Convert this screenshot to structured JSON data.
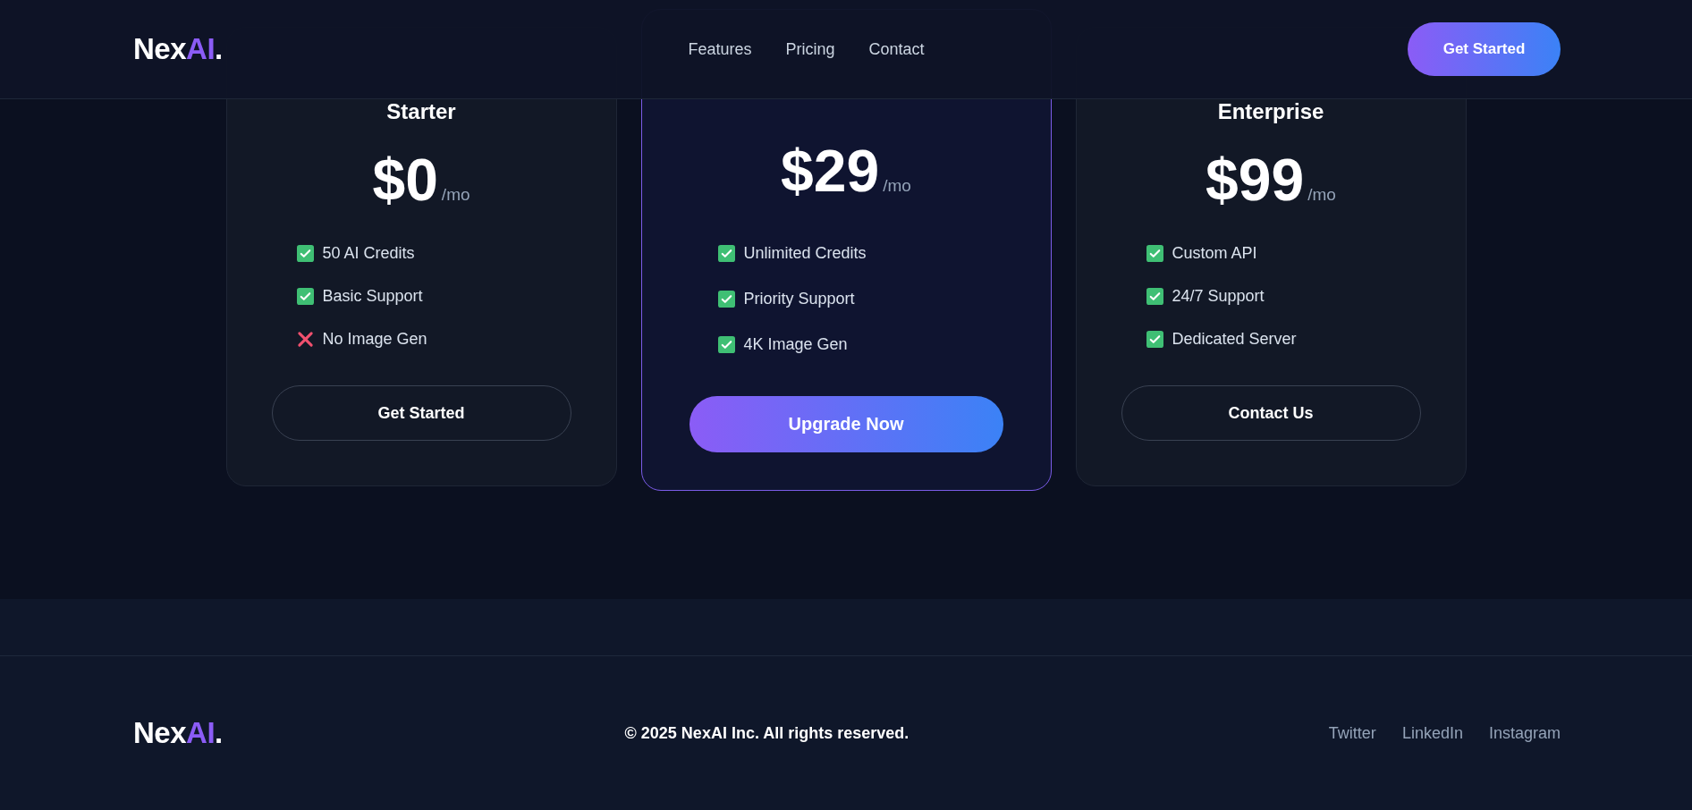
{
  "header": {
    "logo": {
      "text": "Nex",
      "accent": "AI",
      "dot": "."
    },
    "nav": [
      "Features",
      "Pricing",
      "Contact"
    ],
    "cta": "Get Started"
  },
  "plans": [
    {
      "title": "Starter",
      "featured": false,
      "price": "$0",
      "period": "/mo",
      "features": [
        {
          "label": "50 AI Credits",
          "included": true
        },
        {
          "label": "Basic Support",
          "included": true
        },
        {
          "label": "No Image Gen",
          "included": false
        }
      ],
      "button": "Get Started"
    },
    {
      "featured": true,
      "price": "$29",
      "period": "/mo",
      "features": [
        {
          "label": "Unlimited Credits",
          "included": true
        },
        {
          "label": "Priority Support",
          "included": true
        },
        {
          "label": "4K Image Gen",
          "included": true
        }
      ],
      "button": "Upgrade Now"
    },
    {
      "title": "Enterprise",
      "featured": false,
      "price": "$99",
      "period": "/mo",
      "features": [
        {
          "label": "Custom API",
          "included": true
        },
        {
          "label": "24/7 Support",
          "included": true
        },
        {
          "label": "Dedicated Server",
          "included": true
        }
      ],
      "button": "Contact Us"
    }
  ],
  "footer": {
    "logo": {
      "text": "Nex",
      "accent": "AI",
      "dot": "."
    },
    "copyright": "© 2025 NexAI Inc. All rights reserved.",
    "links": [
      "Twitter",
      "LinkedIn",
      "Instagram"
    ]
  }
}
